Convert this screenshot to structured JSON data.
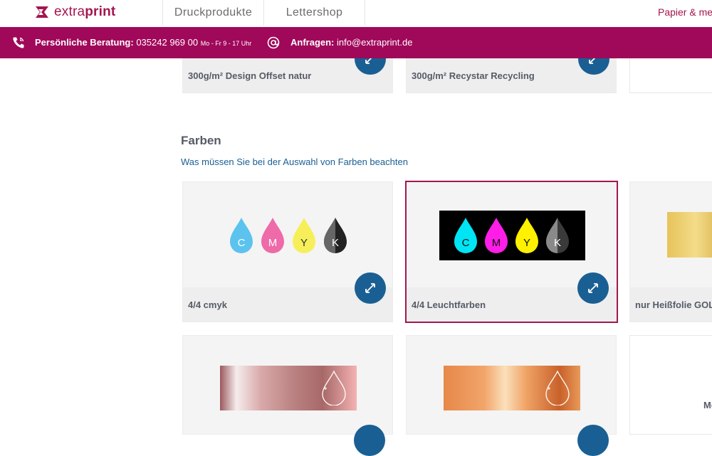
{
  "brand": {
    "name_light": "extra",
    "name_bold": "print",
    "color": "#a3164f"
  },
  "nav": {
    "tabs": [
      {
        "label": "Druckprodukte"
      },
      {
        "label": "Lettershop"
      }
    ],
    "right_link": "Papier & meh"
  },
  "infobar": {
    "color": "#a0085a",
    "consult_label": "Persönliche Beratung:",
    "phone": "035242 969 00",
    "hours": "Mo - Fr 9 - 17 Uhr",
    "inquiry_label": "Anfragen:",
    "email": "info@extraprint.de"
  },
  "paper_cards": [
    {
      "label": "300g/m² Design Offset natur"
    },
    {
      "label": "300g/m² Recystar Recycling"
    },
    {
      "label": ""
    }
  ],
  "colors_section": {
    "title": "Farben",
    "help_link": "Was müssen Sie bei der Auswahl von Farben beachten",
    "cards": [
      {
        "label": "4/4 cmyk",
        "drops": [
          "C",
          "M",
          "Y",
          "K"
        ]
      },
      {
        "label": "4/4 Leuchtfarben",
        "drops": [
          "C",
          "M",
          "Y",
          "K"
        ],
        "selected": true
      },
      {
        "label": "nur Heißfolie GOL"
      }
    ],
    "row2": [
      {
        "label": "",
        "swatch": "rose-gold"
      },
      {
        "label": "",
        "swatch": "copper"
      },
      {
        "label": "Me"
      }
    ]
  },
  "accent_blue": "#1a5f93",
  "icons": [
    "phone-icon",
    "at-icon",
    "expand-icon",
    "logo-mark-icon"
  ]
}
